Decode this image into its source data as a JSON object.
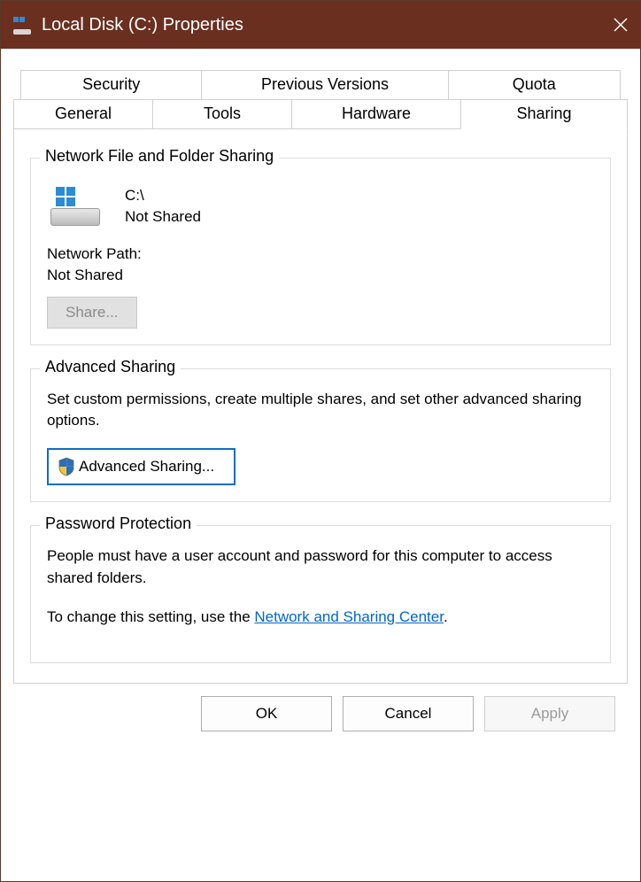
{
  "window": {
    "title": "Local Disk (C:) Properties"
  },
  "tabs": {
    "row1": [
      "Security",
      "Previous Versions",
      "Quota"
    ],
    "row2": [
      "General",
      "Tools",
      "Hardware",
      "Sharing"
    ],
    "active": "Sharing"
  },
  "group_network": {
    "title": "Network File and Folder Sharing",
    "drive": "C:\\",
    "status": "Not Shared",
    "path_label": "Network Path:",
    "path_value": "Not Shared",
    "share_button": "Share..."
  },
  "group_advanced": {
    "title": "Advanced Sharing",
    "desc": "Set custom permissions, create multiple shares, and set other advanced sharing options.",
    "button": "Advanced Sharing..."
  },
  "group_password": {
    "title": "Password Protection",
    "desc": "People must have a user account and password for this computer to access shared folders.",
    "change_prefix": "To change this setting, use the ",
    "link": "Network and Sharing Center",
    "suffix": "."
  },
  "buttons": {
    "ok": "OK",
    "cancel": "Cancel",
    "apply": "Apply"
  }
}
